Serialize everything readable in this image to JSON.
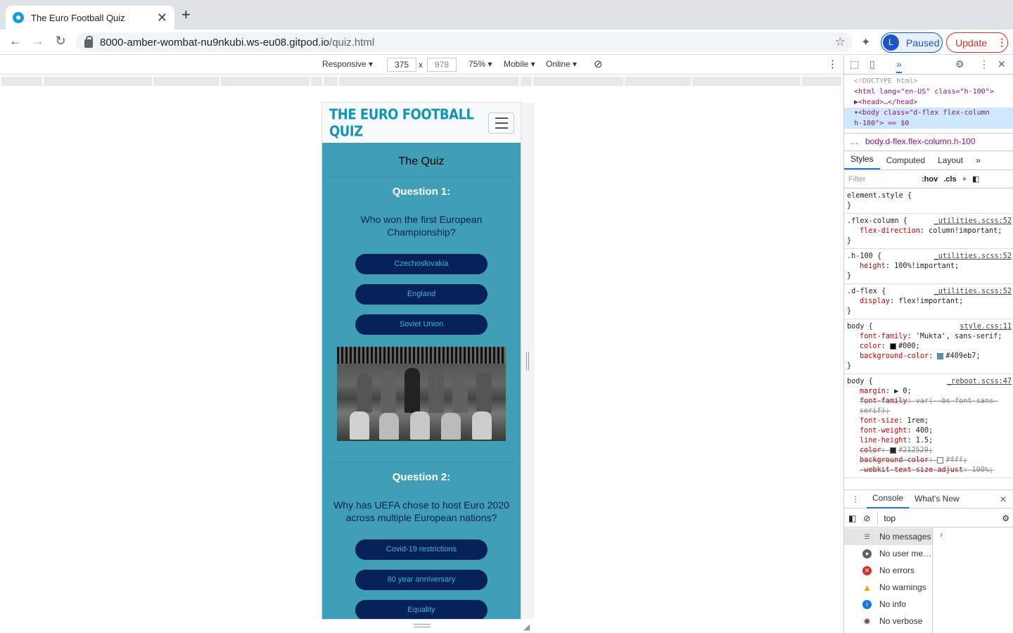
{
  "browser": {
    "tab_title": "The Euro Football Quiz",
    "url_host": "8000-amber-wombat-nu9nkubi.ws-eu08.gitpod.io",
    "url_path": "/quiz.html",
    "profile_initial": "L",
    "profile_status": "Paused",
    "update_label": "Update"
  },
  "device_toolbar": {
    "mode": "Responsive ▾",
    "width": "375",
    "times": "x",
    "height": "978",
    "zoom": "75% ▾",
    "throttle": "Mobile ▾",
    "network": "Online ▾"
  },
  "site": {
    "brand": "THE EURO FOOTBALL QUIZ",
    "heading": "The Quiz",
    "questions": [
      {
        "number": "Question 1:",
        "text": "Who won the first European Championship?",
        "answers": [
          "Czechoslovakia",
          "England",
          "Soviet Union"
        ]
      },
      {
        "number": "Question 2:",
        "text": "Why has UEFA chose to host Euro 2020 across multiple European nations?",
        "answers": [
          "Covid-19 restrictions",
          "60 year anniversary",
          "Equality"
        ]
      }
    ]
  },
  "devtools": {
    "dom_lines": [
      "<!DOCTYPE html>",
      "<html lang=\"en-US\" class=\"h-100\">",
      "▶<head>…</head>",
      "▾<body class=\"d-flex flex-column",
      "h-100\"> == $0"
    ],
    "breadcrumb": "body.d-flex.flex-column.h-100",
    "tabs": [
      "Styles",
      "Computed",
      "Layout",
      "»"
    ],
    "filter_placeholder": "Filter",
    "hov": ":hov",
    "cls": ".cls",
    "rules": [
      {
        "selector": "element.style {",
        "source": "",
        "props": [],
        "close": "}"
      },
      {
        "selector": ".flex-column {",
        "source": "_utilities.scss:52",
        "props": [
          {
            "name": "flex-direction",
            "value": "column!important;"
          }
        ],
        "close": "}"
      },
      {
        "selector": ".h-100 {",
        "source": "_utilities.scss:52",
        "props": [
          {
            "name": "height",
            "value": "100%!important;"
          }
        ],
        "close": "}"
      },
      {
        "selector": ".d-flex {",
        "source": "_utilities.scss:52",
        "props": [
          {
            "name": "display",
            "value": "flex!important;"
          }
        ],
        "close": "}"
      },
      {
        "selector": "body {",
        "source": "style.css:11",
        "props": [
          {
            "name": "font-family",
            "value": "'Mukta', sans-serif;"
          },
          {
            "name": "color",
            "value": "#000;"
          },
          {
            "name": "background-color",
            "value": "#409eb7;"
          }
        ],
        "close": "}"
      },
      {
        "selector": "body {",
        "source": "_reboot.scss:47",
        "props": [
          {
            "name": "margin",
            "value": "▶ 0;"
          },
          {
            "name": "font-family",
            "value": "var(--bs-font-sans-serif);"
          },
          {
            "name": "font-size",
            "value": "1rem;"
          },
          {
            "name": "font-weight",
            "value": "400;"
          },
          {
            "name": "line-height",
            "value": "1.5;"
          },
          {
            "name": "color",
            "value": "#212529;"
          },
          {
            "name": "background-color",
            "value": "#fff;"
          },
          {
            "name": "-webkit-text-size-adjust",
            "value": "100%;"
          }
        ],
        "close": ""
      }
    ],
    "console_tabs": [
      "Console",
      "What's New"
    ],
    "context": "top",
    "message_filters": [
      "No messages",
      "No user me…",
      "No errors",
      "No warnings",
      "No info",
      "No verbose"
    ]
  },
  "colors": {
    "site_bg": "#409eb7",
    "button_bg": "#07215a",
    "brand": "#1496b3",
    "accent": "#1a73e8"
  }
}
